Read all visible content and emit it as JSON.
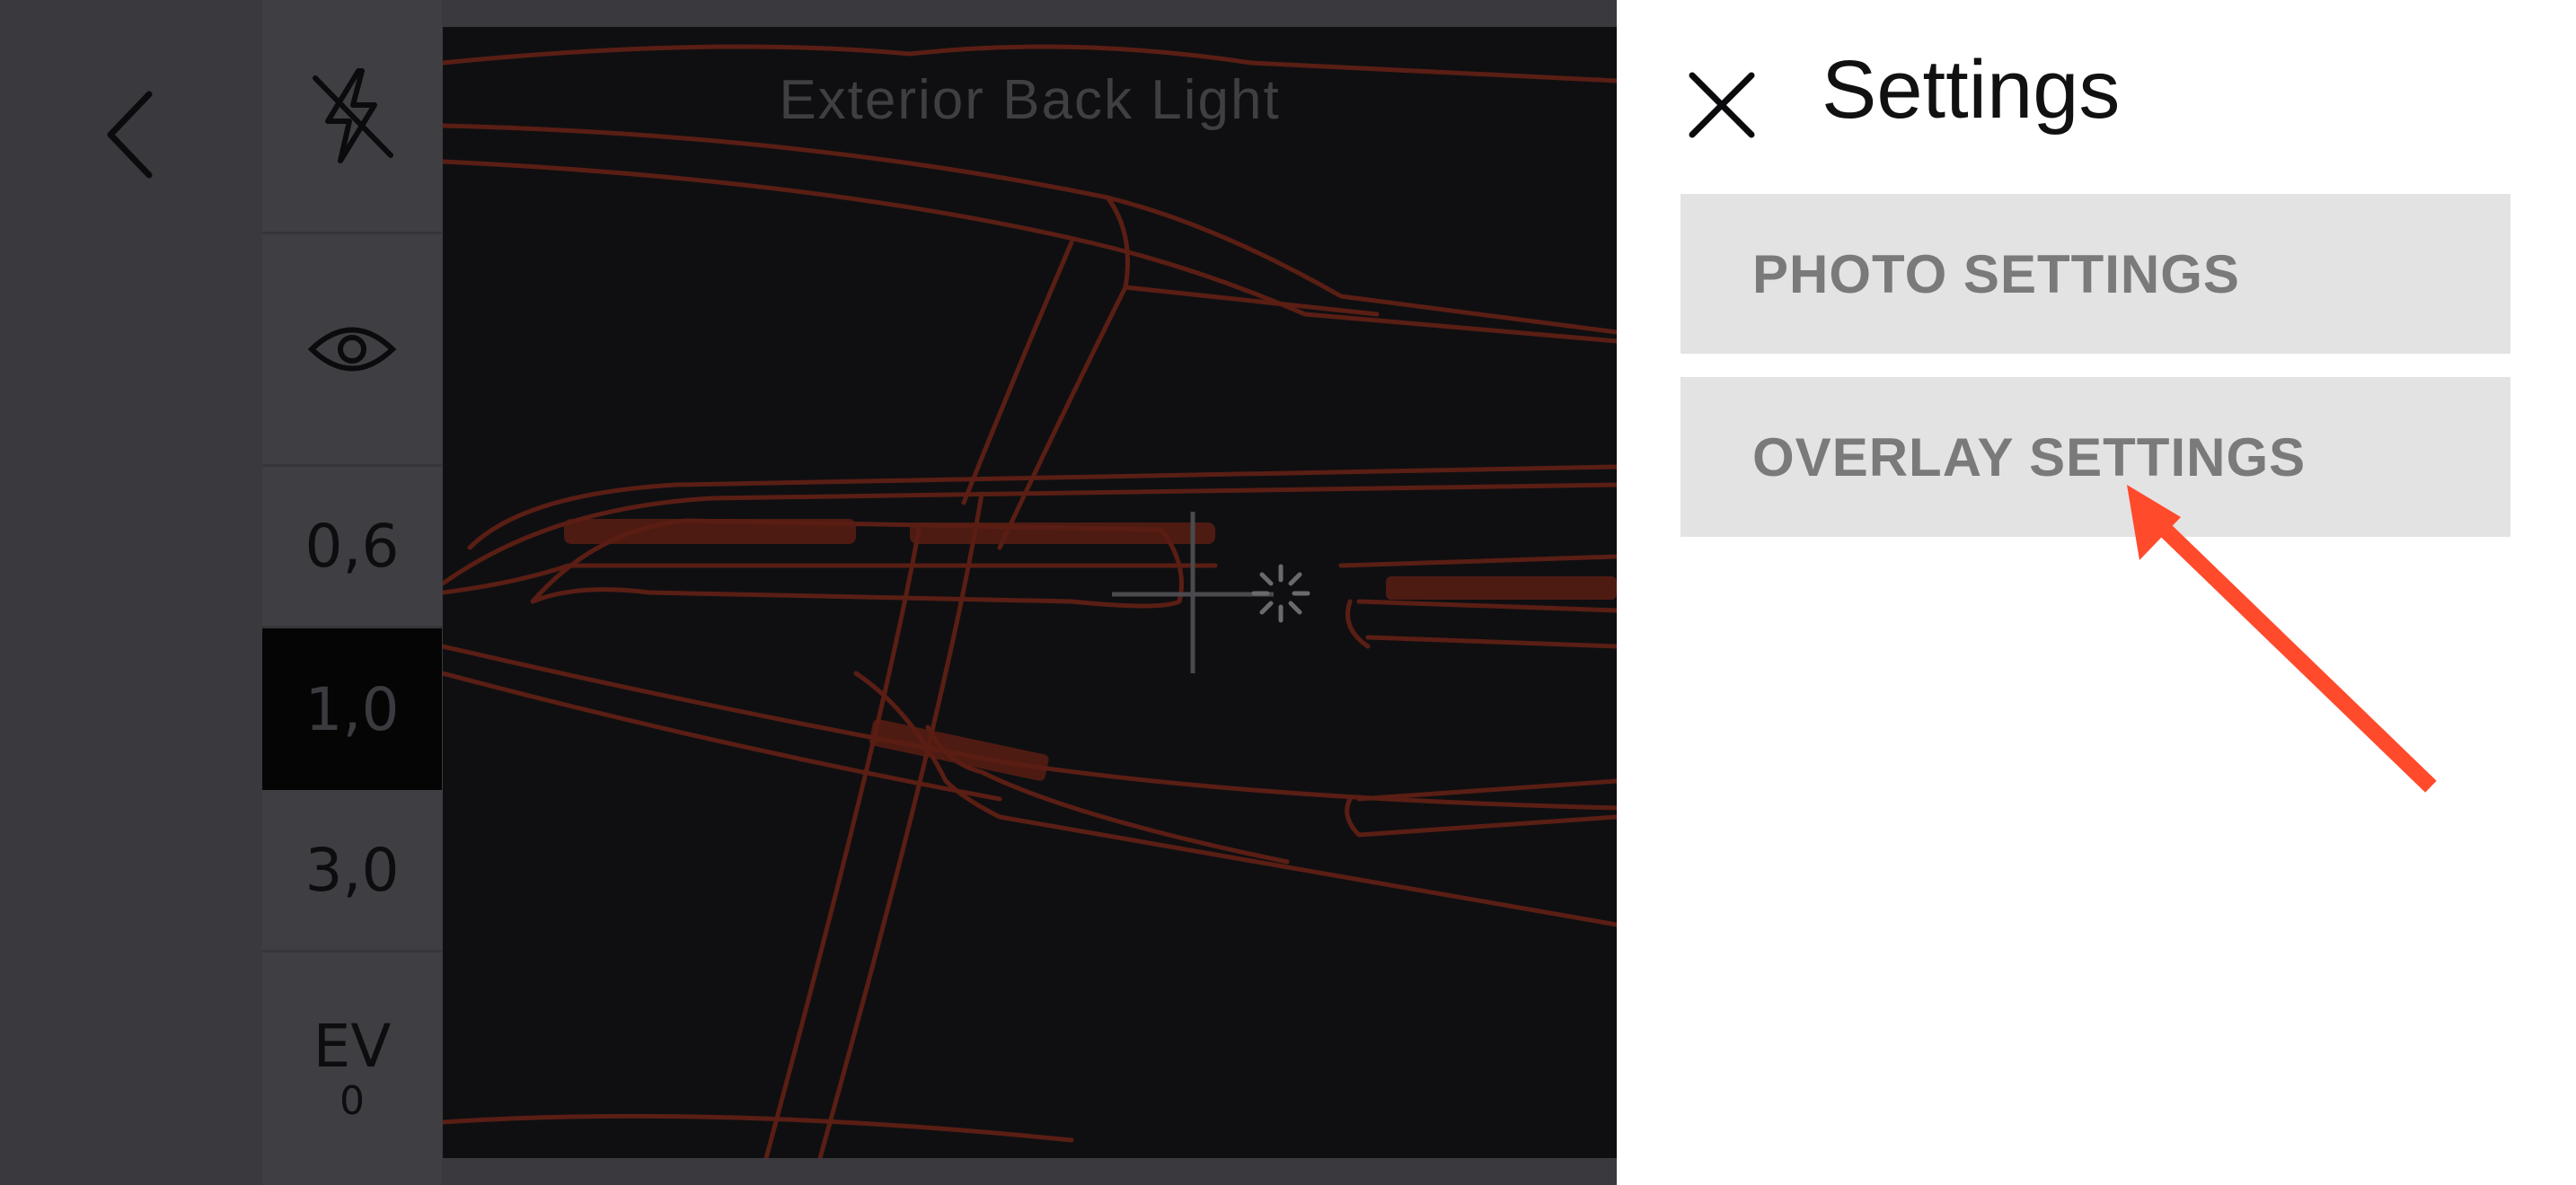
{
  "toolbar": {
    "zoom_options": [
      "0,6",
      "1,0",
      "3,0"
    ],
    "selected_zoom": "1,0",
    "ev_label": "EV",
    "ev_value": "0",
    "icons": [
      "back-chevron-icon",
      "flash-off-icon",
      "eye-icon"
    ]
  },
  "viewfinder": {
    "title": "Exterior Back Light"
  },
  "settings_panel": {
    "title": "Settings",
    "items": [
      {
        "label": "PHOTO SETTINGS"
      },
      {
        "label": "OVERLAY SETTINGS"
      }
    ]
  },
  "colors": {
    "panel_bg": "#ffffff",
    "menu_bg": "#e3e3e3",
    "overlay_stroke": "#5a1e14",
    "annotation_arrow": "#ff4a2b"
  }
}
